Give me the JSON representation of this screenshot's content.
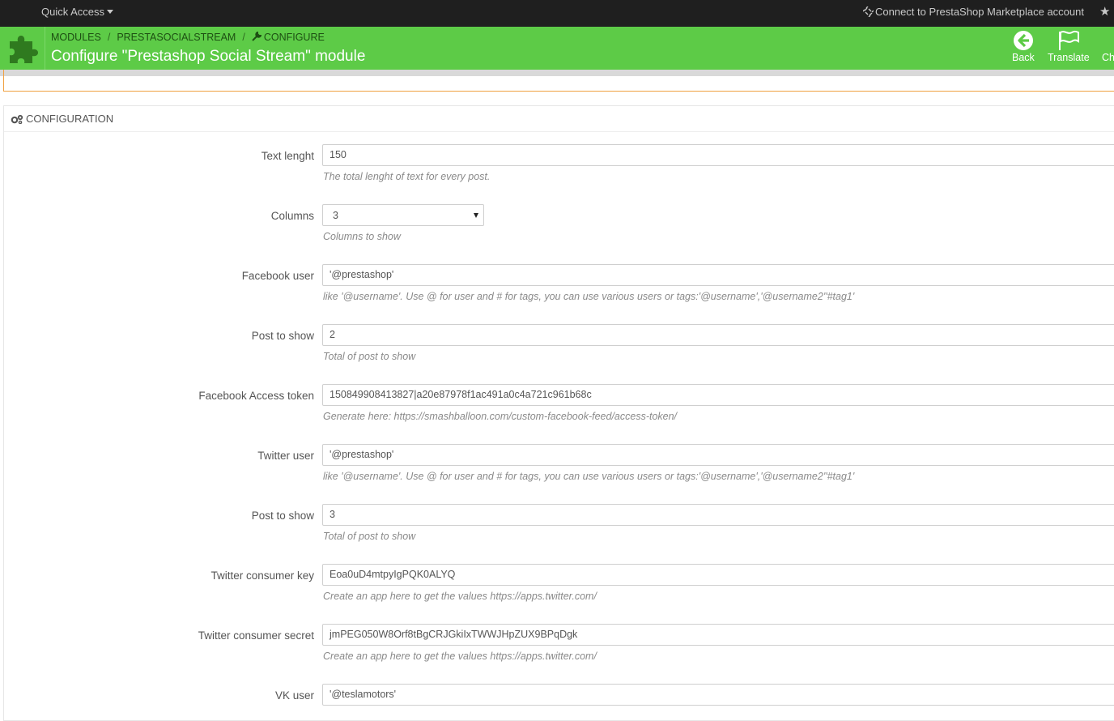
{
  "topbar": {
    "quick_access": "Quick Access",
    "connect": "Connect to PrestaShop Marketplace account"
  },
  "header": {
    "breadcrumb": [
      "MODULES",
      "PRESTASOCIALSTREAM",
      "CONFIGURE"
    ],
    "title": "Configure \"Prestashop Social Stream\" module",
    "buttons": {
      "back": "Back",
      "translate": "Translate",
      "check": "Ch"
    },
    "colors": {
      "header_bg": "#5dcb47",
      "topbar_bg": "#1f1f1f",
      "accent_orange": "#f0a040"
    }
  },
  "panel": {
    "heading": "CONFIGURATION",
    "fields": [
      {
        "label": "Text lenght",
        "value": "150",
        "help": "The total lenght of text for every post."
      },
      {
        "label": "Columns",
        "value": "3",
        "help": "Columns to show"
      },
      {
        "label": "Facebook user",
        "value": "'@prestashop'",
        "help": "like '@username'. Use @ for user and # for tags, you can use various users or tags:'@username','@username2''#tag1'"
      },
      {
        "label": "Post to show",
        "value": "2",
        "help": "Total of post to show"
      },
      {
        "label": "Facebook Access token",
        "value": "150849908413827|a20e87978f1ac491a0c4a721c961b68c",
        "help": "Generate here: https://smashballoon.com/custom-facebook-feed/access-token/"
      },
      {
        "label": "Twitter user",
        "value": "'@prestashop'",
        "help": "like '@username'. Use @ for user and # for tags, you can use various users or tags:'@username','@username2''#tag1'"
      },
      {
        "label": "Post to show",
        "value": "3",
        "help": "Total of post to show"
      },
      {
        "label": "Twitter consumer key",
        "value": "Eoa0uD4mtpyIgPQK0ALYQ",
        "help": "Create an app here to get the values https://apps.twitter.com/"
      },
      {
        "label": "Twitter consumer secret",
        "value": "jmPEG050W8Orf8tBgCRJGkiIxTWWJHpZUX9BPqDgk",
        "help": "Create an app here to get the values https://apps.twitter.com/"
      },
      {
        "label": "VK user",
        "value": "'@teslamotors'",
        "help": ""
      }
    ]
  }
}
